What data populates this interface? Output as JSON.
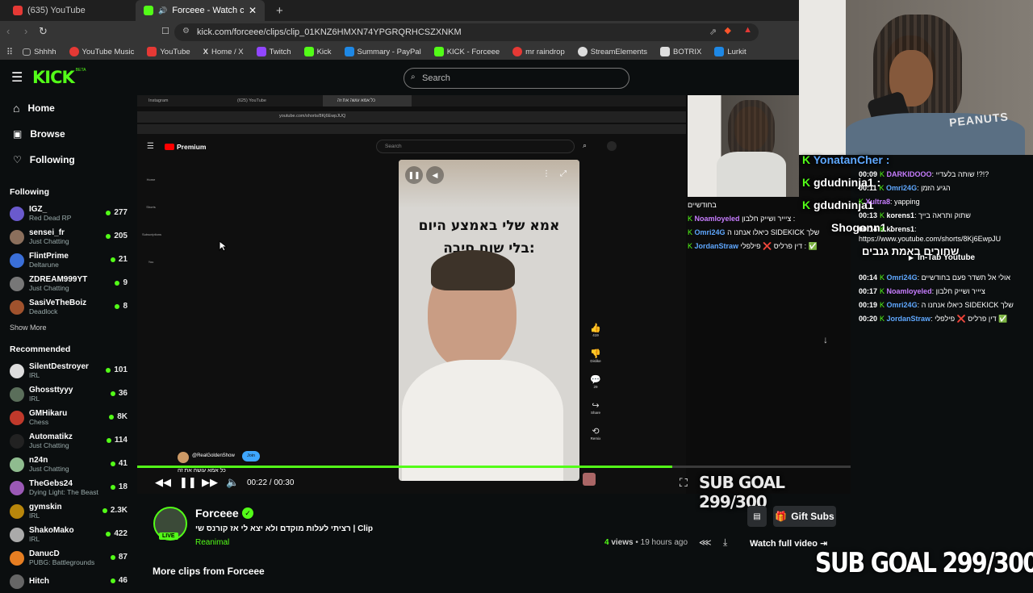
{
  "browser": {
    "tabs": [
      {
        "label": "(635) YouTube",
        "active": false
      },
      {
        "label": "Forceee - Watch clips on Kick",
        "active": true
      }
    ],
    "url": "kick.com/forceee/clips/clip_01KNZ6HMXN74YPGRQRHCSZXNKM",
    "bookmarks": [
      "Shhhh",
      "YouTube Music",
      "YouTube",
      "Home / X",
      "Twitch",
      "Kick",
      "Summary - PayPal",
      "KICK - Forceee",
      "mr raindrop",
      "StreamElements",
      "BOTRIX",
      "Lurkit"
    ]
  },
  "kick": {
    "logo": "KICK",
    "logo_sup": "BETA",
    "search_placeholder": "Search",
    "nav": [
      {
        "label": "Home",
        "icon": "home-icon"
      },
      {
        "label": "Browse",
        "icon": "browse-icon"
      },
      {
        "label": "Following",
        "icon": "heart-icon"
      }
    ],
    "following_header": "Following",
    "following": [
      {
        "name": "IGZ_",
        "sub": "Red Dead RP",
        "count": "277",
        "color": "#6a5acd"
      },
      {
        "name": "sensei_fr",
        "sub": "Just Chatting",
        "count": "205",
        "color": "#8b6f5c"
      },
      {
        "name": "FlintPrime",
        "sub": "Deltarune",
        "count": "21",
        "color": "#3a6fd8"
      },
      {
        "name": "ZDREAM999YT",
        "sub": "Just Chatting",
        "count": "9",
        "color": "#777"
      },
      {
        "name": "SasiVeTheBoiz",
        "sub": "Deadlock",
        "count": "8",
        "color": "#a0522d"
      }
    ],
    "show_more": "Show More",
    "recommended_header": "Recommended",
    "recommended": [
      {
        "name": "SilentDestroyer",
        "sub": "IRL",
        "count": "101",
        "color": "#ddd"
      },
      {
        "name": "Ghossttyyy",
        "sub": "IRL",
        "count": "36",
        "color": "#5a6e5a"
      },
      {
        "name": "GMHikaru",
        "sub": "Chess",
        "count": "8K",
        "color": "#c0392b"
      },
      {
        "name": "Automatikz",
        "sub": "Just Chatting",
        "count": "114",
        "color": "#222"
      },
      {
        "name": "n24n",
        "sub": "Just Chatting",
        "count": "41",
        "color": "#8fbc8f"
      },
      {
        "name": "TheGebs24",
        "sub": "Dying Light: The Beast",
        "count": "18",
        "color": "#9b59b6"
      },
      {
        "name": "gymskin",
        "sub": "IRL",
        "count": "2.3K",
        "color": "#b8860b"
      },
      {
        "name": "ShakoMako",
        "sub": "IRL",
        "count": "422",
        "color": "#aaa"
      },
      {
        "name": "DanucD",
        "sub": "PUBG: Battlegrounds",
        "count": "87",
        "color": "#e67e22"
      },
      {
        "name": "Hitch",
        "sub": "",
        "count": "46",
        "color": "#666"
      }
    ]
  },
  "nested_youtube": {
    "tabs": [
      "Instagram",
      "(625) YouTube",
      "כל אמא עושה את זה"
    ],
    "url": "youtube.com/shorts/8Kj6EwpJUQ",
    "logo": "Premium",
    "search_placeholder": "Search",
    "side": [
      "Home",
      "Shorts",
      "Subscriptions",
      "You"
    ],
    "short_caption_line1": "אמא שלי באמצע היום",
    "short_caption_line2": "בלי שום סיבה:",
    "channel": "@RealGoldenShow",
    "join": "Join",
    "title": "כל אמא עושה את זה",
    "likes": "419",
    "dislike": "Dislike",
    "comments": "29",
    "share": "Share",
    "remix": "Remix"
  },
  "player": {
    "time": "00:22 / 00:30",
    "progress": 0.75
  },
  "overlay": {
    "sub_goal": "SUB GOAL 299/300",
    "sub_goal_small": "SUB GOAL 299/300",
    "big_names": [
      "YonatanCher :",
      "gdudninja1 :",
      "gdudninja1",
      "Shogonn1 :"
    ],
    "big_title_line": "שחורים באמת גנבים"
  },
  "chat_left": [
    {
      "text": "בחודשיים"
    },
    {
      "user": "Noamloyeled",
      "text": "ציייר ושייק חלבון :",
      "color": "#c77dff"
    },
    {
      "user": "Omri24G",
      "text": "כיאלו אנחנו ה SIDEKICK שלך",
      "color": "#5fa8ff"
    },
    {
      "user": "JordanStraw",
      "text": "דין פרליס ❌ פילפלי :",
      "color": "#5fa8ff"
    }
  ],
  "chat": [
    {
      "ts": "00:09",
      "user": "DARKIDOOO",
      "text": "שותה בלעדיי !?!?",
      "color": "#c77dff"
    },
    {
      "ts": "00:11",
      "user": "Omri24G",
      "text": "הגיע הזמן",
      "color": "#5fa8ff"
    },
    {
      "ts": "",
      "user": "Xultra8",
      "text": "yapping",
      "color": "#c77dff"
    },
    {
      "ts": "00:13",
      "user": "korens1",
      "text": "שתוק ותראה בייך",
      "color": "#ffffff"
    },
    {
      "ts": "00:14",
      "user": "korens1",
      "text": "https://www.youtube.com/shorts/8Kj6EwpJU",
      "color": "#ffffff"
    },
    {
      "ts": "00:14",
      "user": "Omri24G",
      "text": "אולי אל תשדר פעם בחודשיים",
      "color": "#5fa8ff"
    },
    {
      "ts": "00:17",
      "user": "Noamloyeled",
      "text": "ציייר ושייק חלבון",
      "color": "#c77dff"
    },
    {
      "ts": "00:19",
      "user": "Omri24G",
      "text": "כיאלו אנחנו ה SIDEKICK שלך",
      "color": "#5fa8ff"
    },
    {
      "ts": "00:20",
      "user": "JordanStraw",
      "text": "דין פרליס ❌ פילפלי ✅",
      "color": "#5fa8ff"
    }
  ],
  "in_tab": "In-Tab Youtube",
  "clip": {
    "channel": "Forceee",
    "live": "LIVE",
    "title": "רציתי לעלות מוקדם ולא יצא לי אז קורנס שי | Clip",
    "category": "Reanimal",
    "views": "4",
    "views_label": "views",
    "ago": "19 hours ago",
    "gift_subs": "Gift Subs",
    "watch_full": "Watch full video",
    "more_clips": "More clips from Forceee"
  }
}
